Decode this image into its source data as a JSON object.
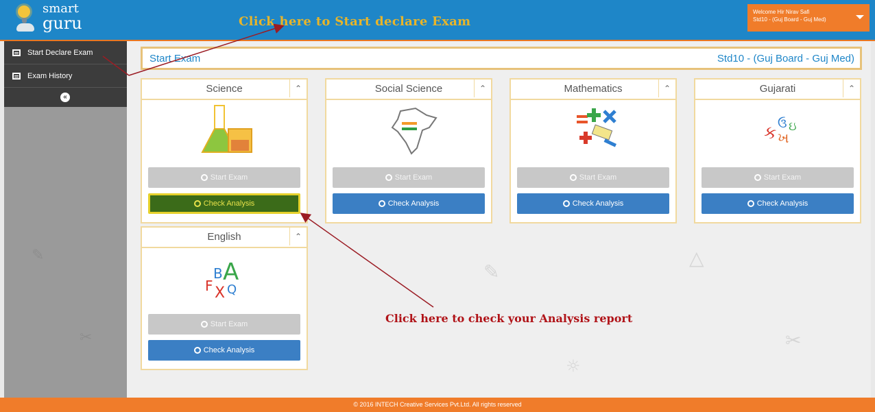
{
  "header": {
    "brand_line1": "smart",
    "brand_line2": "guru",
    "callout_top": "Click here to Start declare Exam",
    "welcome_line1": "Welcome Hir Nirav Safi",
    "welcome_line2": "Std10 - (Guj Board - Guj Med)"
  },
  "sidebar": {
    "items": [
      {
        "label": "Start Declare Exam"
      },
      {
        "label": "Exam History"
      }
    ],
    "collapse_glyph": "«"
  },
  "main": {
    "title": "Start Exam",
    "std_info": "Std10 - (Guj Board - Guj Med)",
    "subjects": [
      {
        "name": "Science",
        "start_label": "Start Exam",
        "check_label": "Check Analysis"
      },
      {
        "name": "Social Science",
        "start_label": "Start Exam",
        "check_label": "Check Analysis"
      },
      {
        "name": "Mathematics",
        "start_label": "Start Exam",
        "check_label": "Check Analysis"
      },
      {
        "name": "Gujarati",
        "start_label": "Start Exam",
        "check_label": "Check Analysis"
      },
      {
        "name": "English",
        "start_label": "Start Exam",
        "check_label": "Check Analysis"
      }
    ],
    "english_art": {
      "l1": "B",
      "l2": "A",
      "l3": "F",
      "l4": "X",
      "l5": "Q"
    },
    "gujarati_art": {
      "g1": "ક",
      "g2": "ઉ",
      "g3": "ખ",
      "g4": "ઇ"
    }
  },
  "callout_bottom": "Click here to check your Analysis report",
  "footer": {
    "text": "© 2016 INTECH Creative Services Pvt.Ltd. All rights reserved"
  },
  "colors": {
    "topbar": "#1e86c8",
    "accent": "#f07c2a",
    "check_button": "#3b7fc4",
    "highlight_button": "#3b6b19"
  }
}
